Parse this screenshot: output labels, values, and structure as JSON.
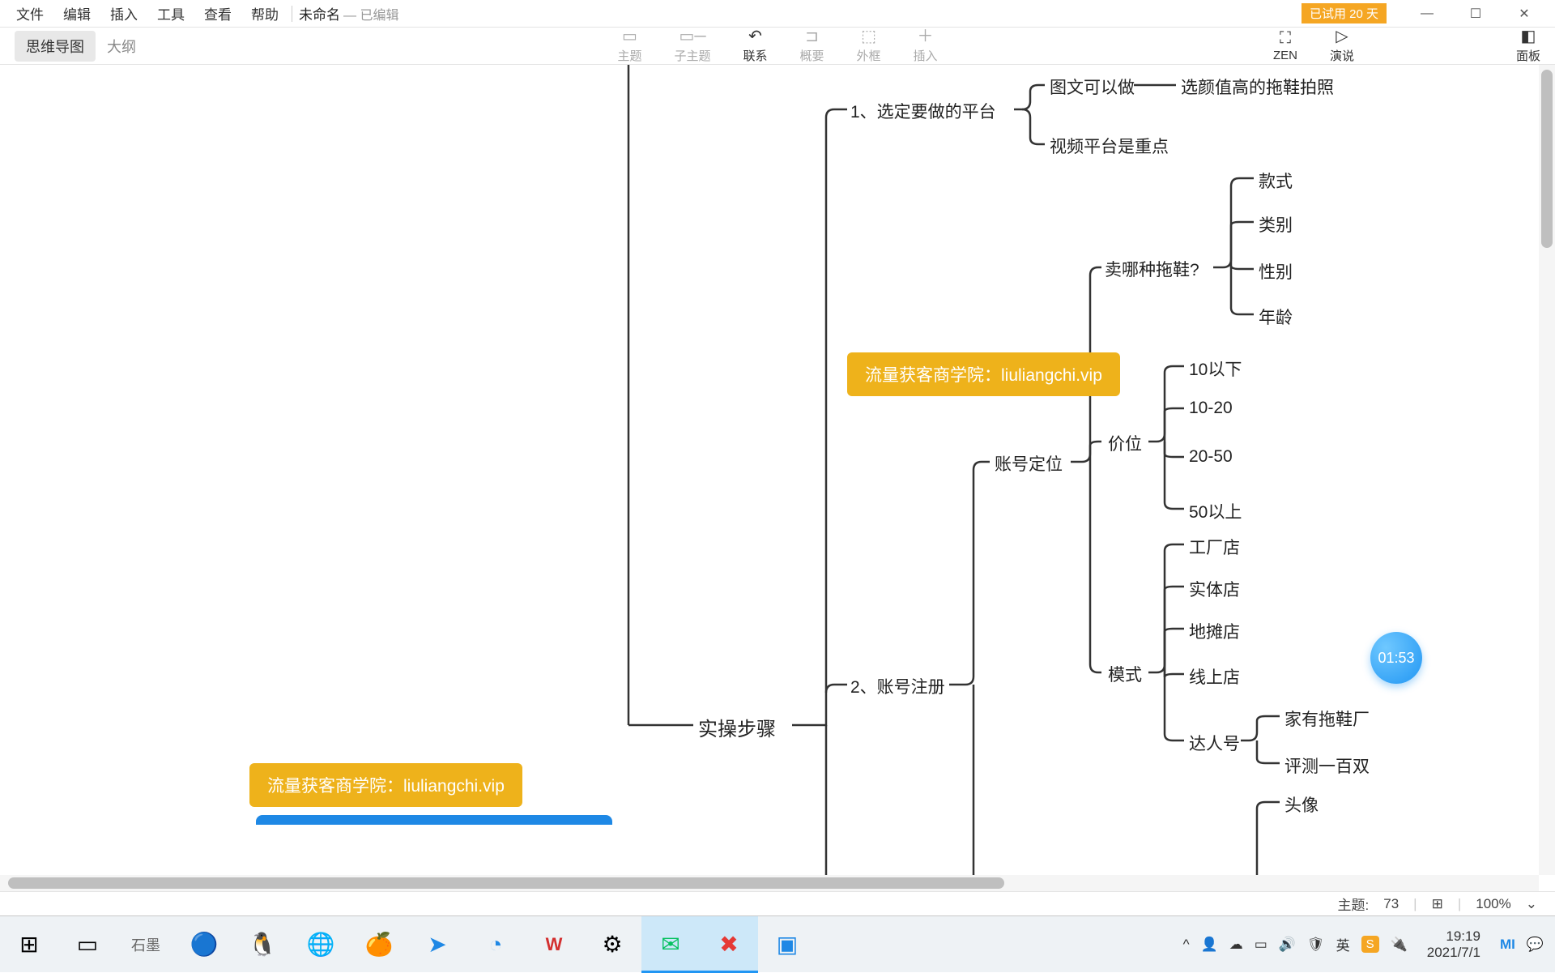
{
  "menu": {
    "file": "文件",
    "edit": "编辑",
    "insert": "插入",
    "tools": "工具",
    "view": "查看",
    "help": "帮助"
  },
  "doc": {
    "name": "未命名",
    "status": "— 已编辑"
  },
  "trial": "已试用 20 天",
  "viewtabs": {
    "mindmap": "思维导图",
    "outline": "大纲"
  },
  "toolbar": {
    "topic": "主题",
    "subtopic": "子主题",
    "relation": "联系",
    "summary": "概要",
    "boundary": "外框",
    "insert": "插入",
    "zen": "ZEN",
    "present": "演说",
    "panel": "面板"
  },
  "status": {
    "topics_label": "主题:",
    "topics_count": "73",
    "zoom": "100%"
  },
  "timer": "01:53",
  "watermark": "流量获客商学院：liuliangchi.vip",
  "nodes": {
    "root": "实操步骤",
    "n1": "1、选定要做的平台",
    "n1a": "图文可以做",
    "n1a1": "选颜值高的拖鞋拍照",
    "n1b": "视频平台是重点",
    "n2": "2、账号注册",
    "n2a": "账号定位",
    "n2a1": "卖哪种拖鞋?",
    "n2a1a": "款式",
    "n2a1b": "类别",
    "n2a1c": "性别",
    "n2a1d": "年龄",
    "n2a2": "价位",
    "n2a2a": "10以下",
    "n2a2b": "10-20",
    "n2a2c": "20-50",
    "n2a2d": "50以上",
    "n2a3": "模式",
    "n2a3a": "工厂店",
    "n2a3b": "实体店",
    "n2a3c": "地摊店",
    "n2a3d": "线上店",
    "n2a3e": "达人号",
    "n2a3e1": "家有拖鞋厂",
    "n2a3e2": "评测一百双",
    "n2a4": "头像"
  },
  "systime": {
    "time": "19:19",
    "date": "2021/7/1"
  }
}
